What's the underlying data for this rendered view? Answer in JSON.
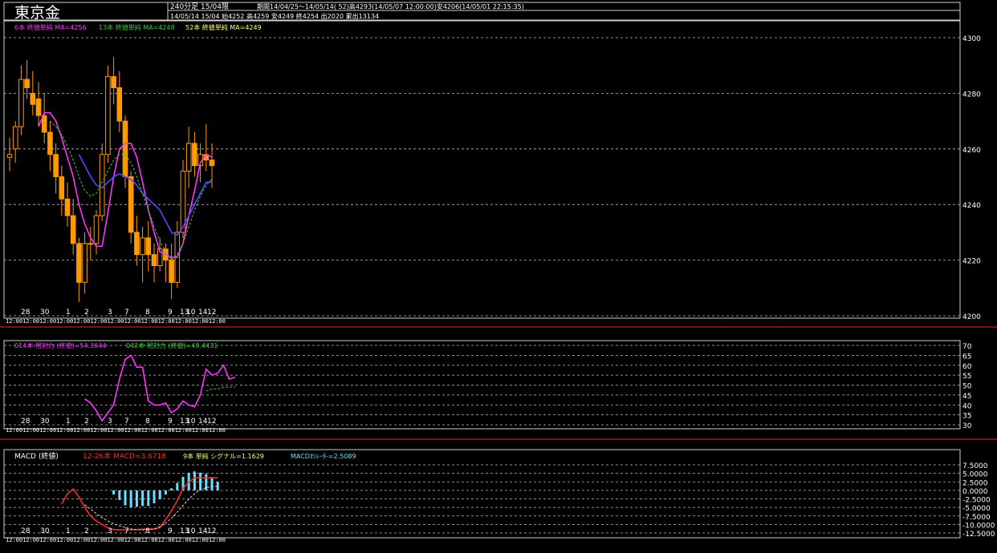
{
  "app": {
    "symbol": "東京金",
    "timeframe_line": "240分足 15/04限",
    "period_line": "期間14/04/25～14/05/14( 52)高4293(14/05/07 12:00:00)安4206(14/05/01 22:15:35)",
    "last_bar_line": "14/05/14 15/04 始4252 高4259 安4249 終4254 出2020 累出13134"
  },
  "colors": {
    "background": "#000000",
    "grid": "#bdbdbd",
    "candle": "#ff9900",
    "ma_short": "#ff33ff",
    "ma_mid": "#4d4dff",
    "ma_long": "#33cc33",
    "rsi14": "#ff33ff",
    "rsi42": "#33cc33",
    "macd": "#ff2a2a",
    "signal": "#d9d9d9",
    "oscillator": "#66e0ff",
    "separator": "#ff2222"
  },
  "x_labels": {
    "days": [
      "28",
      "30",
      "1",
      "2",
      "3",
      "7",
      "8",
      "9",
      "10",
      "12",
      "13",
      "14"
    ],
    "cutoff_1": "28",
    "cutoff_2": "30",
    "cutoff_3": "2",
    "time_row": "12:0012:0012:0012:0012:0012:0012:0012:0012:0012:0012:0012:0012:00"
  },
  "price_legend": {
    "ma6": "6本 終値単純 MA=4256",
    "ma13": "13本 終値単純 MA=4248",
    "ma52": "52本 終値単純 MA=4249"
  },
  "rsi_legend": {
    "rsi14": "014本 相対力 (終値)=54.3644",
    "rsi42": "042本 相対力 (終値)=49.4431"
  },
  "macd_legend": {
    "title": "MACD (終値)",
    "macd": "12-26本 MACD=3.6718",
    "signal": "9本 単純 シグナル=1.1629",
    "osc": "MACDｵｼﾚｰﾀ-=2.5089"
  },
  "chart_data": [
    {
      "type": "candlestick",
      "name_panel": "price",
      "ylim": [
        4200,
        4300
      ],
      "y_ticks": [
        "4300",
        "4280",
        "4260",
        "4240",
        "4220",
        "4200"
      ],
      "candles": [
        [
          4257,
          4264,
          4252,
          4258
        ],
        [
          4260,
          4270,
          4255,
          4268
        ],
        [
          4268,
          4290,
          4265,
          4285
        ],
        [
          4285,
          4292,
          4278,
          4282
        ],
        [
          4280,
          4288,
          4272,
          4276
        ],
        [
          4278,
          4284,
          4268,
          4272
        ],
        [
          4272,
          4280,
          4262,
          4266
        ],
        [
          4266,
          4270,
          4252,
          4258
        ],
        [
          4258,
          4262,
          4244,
          4250
        ],
        [
          4250,
          4254,
          4236,
          4242
        ],
        [
          4242,
          4248,
          4232,
          4236
        ],
        [
          4236,
          4242,
          4222,
          4226
        ],
        [
          4226,
          4228,
          4205,
          4212
        ],
        [
          4212,
          4230,
          4208,
          4226
        ],
        [
          4226,
          4232,
          4220,
          4226
        ],
        [
          4226,
          4238,
          4222,
          4236
        ],
        [
          4236,
          4262,
          4234,
          4258
        ],
        [
          4258,
          4290,
          4255,
          4286
        ],
        [
          4286,
          4293,
          4276,
          4282
        ],
        [
          4282,
          4288,
          4266,
          4270
        ],
        [
          4270,
          4272,
          4246,
          4250
        ],
        [
          4250,
          4252,
          4226,
          4230
        ],
        [
          4230,
          4236,
          4218,
          4222
        ],
        [
          4222,
          4232,
          4212,
          4228
        ],
        [
          4228,
          4234,
          4216,
          4222
        ],
        [
          4222,
          4226,
          4212,
          4218
        ],
        [
          4218,
          4228,
          4216,
          4224
        ],
        [
          4224,
          4226,
          4212,
          4220
        ],
        [
          4220,
          4226,
          4206,
          4212
        ],
        [
          4212,
          4234,
          4210,
          4230
        ],
        [
          4230,
          4256,
          4228,
          4252
        ],
        [
          4252,
          4268,
          4246,
          4262
        ],
        [
          4262,
          4266,
          4250,
          4254
        ],
        [
          4254,
          4262,
          4248,
          4258
        ],
        [
          4258,
          4269,
          4252,
          4256
        ],
        [
          4256,
          4262,
          4246,
          4254
        ]
      ],
      "series": [
        {
          "name": "6本 終値単純",
          "color": "#ff33ff",
          "values": [
            null,
            null,
            null,
            null,
            null,
            4268,
            4273,
            4273,
            4270,
            4264,
            4257,
            4250,
            4240,
            4233,
            4228,
            4225,
            4225,
            4237,
            4250,
            4260,
            4262,
            4262,
            4257,
            4248,
            4238,
            4230,
            4223,
            4222,
            4221,
            4221,
            4226,
            4236,
            4245,
            4255,
            4258,
            4257
          ]
        },
        {
          "name": "13本 終値単純",
          "color": "#4d4dff",
          "values": [
            null,
            null,
            null,
            null,
            null,
            null,
            null,
            null,
            null,
            null,
            null,
            null,
            4258,
            4254,
            4250,
            4247,
            4246,
            4248,
            4250,
            4251,
            4250,
            4249,
            4247,
            4244,
            4242,
            4240,
            4238,
            4234,
            4230,
            4229,
            4232,
            4236,
            4240,
            4244,
            4248,
            4248
          ]
        },
        {
          "name": "52本 終値単純",
          "color": "#33cc33",
          "dash": true,
          "values": [
            null,
            null,
            null,
            null,
            null,
            null,
            null,
            4270,
            4268,
            4265,
            4261,
            4256,
            4250,
            4245,
            4243,
            4244,
            4248,
            4252,
            4256,
            4258,
            4258,
            4255,
            4250,
            4244,
            4238,
            4232,
            4227,
            4223,
            4220,
            4222,
            4226,
            4232,
            4238,
            4243,
            4247,
            4249
          ]
        }
      ]
    },
    {
      "type": "line",
      "name_panel": "rsi",
      "ylim": [
        30,
        70
      ],
      "y_ticks": [
        "70",
        "65",
        "60",
        "55",
        "50",
        "45",
        "40",
        "35",
        "30"
      ],
      "series": [
        {
          "name": "014本 相対力 (終値)",
          "color": "#ff33ff",
          "values": [
            null,
            null,
            null,
            null,
            null,
            null,
            null,
            null,
            null,
            null,
            null,
            null,
            null,
            43,
            41,
            37,
            32,
            36,
            40,
            53,
            63,
            65,
            59,
            59,
            42,
            40,
            40,
            41,
            36,
            38,
            42,
            40,
            39,
            45,
            58,
            55,
            56,
            60,
            53,
            54
          ]
        },
        {
          "name": "042本 相対力 (終値)",
          "color": "#33cc33",
          "dash": true,
          "values": [
            null,
            null,
            null,
            null,
            null,
            null,
            null,
            null,
            null,
            null,
            null,
            null,
            null,
            null,
            null,
            null,
            null,
            null,
            null,
            null,
            null,
            null,
            null,
            null,
            null,
            null,
            null,
            null,
            null,
            null,
            null,
            null,
            null,
            null,
            47,
            48,
            48,
            49,
            49,
            49
          ]
        }
      ]
    },
    {
      "type": "bar+line",
      "name_panel": "macd",
      "ylim": [
        -12.5,
        7.5
      ],
      "y_ticks": [
        "7.5000",
        "5.0000",
        "2.5000",
        "0.0000",
        "-2.5000",
        "-5.0000",
        "-7.5000",
        "-10.0000",
        "-12.5000"
      ],
      "oscillator": [
        null,
        null,
        null,
        null,
        null,
        null,
        null,
        null,
        null,
        null,
        null,
        null,
        null,
        null,
        null,
        null,
        null,
        null,
        -1.2,
        -2.8,
        -4.4,
        -5.0,
        -4.8,
        -4.6,
        -4.6,
        -3.8,
        -2.6,
        -1.2,
        0.6,
        2.2,
        4.0,
        5.2,
        5.6,
        5.2,
        4.8,
        3.6,
        2.5
      ],
      "series": [
        {
          "name": "MACD",
          "color": "#ff2a2a",
          "values": [
            null,
            null,
            null,
            null,
            null,
            null,
            null,
            null,
            null,
            -4.0,
            -1.0,
            0.4,
            -2.0,
            -5.0,
            -7.5,
            -9.0,
            -10.0,
            -11.0,
            -11.5,
            -11.6,
            -11.6,
            -11.6,
            -11.5,
            -11.4,
            -11.3,
            -11.4,
            -11.0,
            -8.5,
            -6.0,
            -3.0,
            0.6,
            2.4,
            3.7,
            3.8,
            3.6,
            3.7,
            3.7
          ]
        },
        {
          "name": "シグナル",
          "color": "#d9d9d9",
          "dash": true,
          "values": [
            null,
            null,
            null,
            null,
            null,
            null,
            null,
            null,
            null,
            null,
            null,
            null,
            null,
            -4.2,
            -5.5,
            -6.8,
            -8.0,
            -9.0,
            -9.8,
            -10.4,
            -10.9,
            -11.3,
            -11.5,
            -11.6,
            -11.5,
            -11.3,
            -10.6,
            -9.6,
            -8.2,
            -6.4,
            -4.4,
            -2.6,
            -1.0,
            0.2,
            0.8,
            1.1,
            1.16
          ]
        }
      ]
    }
  ]
}
